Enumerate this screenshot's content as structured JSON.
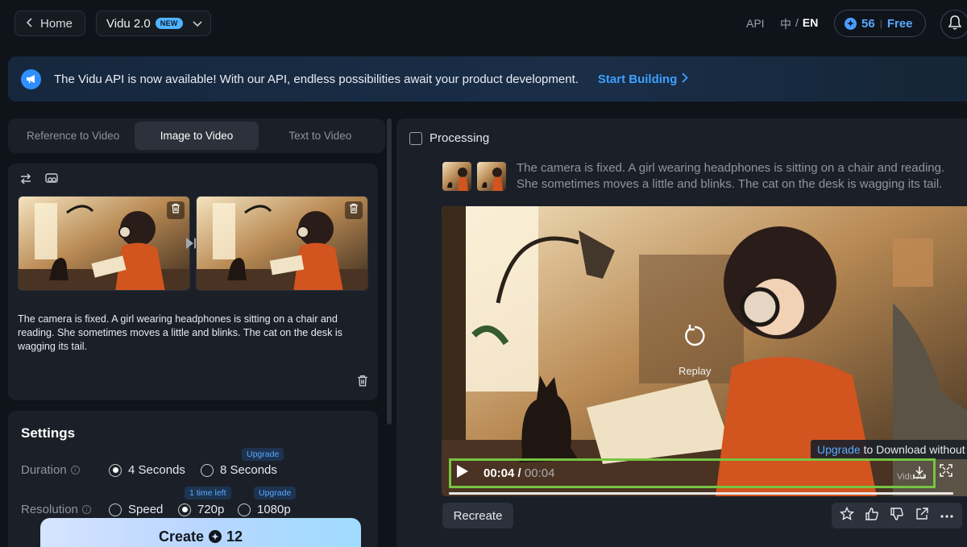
{
  "header": {
    "home_label": "Home",
    "model_label": "Vidu 2.0",
    "new_badge": "NEW",
    "api_label": "API",
    "lang_zh": "中",
    "lang_sep": "/",
    "lang_en": "EN",
    "credits_value": "56",
    "credits_sep": "|",
    "plan_label": "Free"
  },
  "banner": {
    "text": "The Vidu API is now available! With our API, endless possibilities await your product development.",
    "link_label": "Start Building"
  },
  "tabs": [
    {
      "label": "Reference to Video",
      "active": false
    },
    {
      "label": "Image to Video",
      "active": true
    },
    {
      "label": "Text to Video",
      "active": false
    }
  ],
  "input": {
    "prompt": "The camera is fixed. A girl wearing headphones is sitting on a chair and reading. She sometimes moves a little and blinks. The cat on the desk is wagging its tail."
  },
  "settings": {
    "title": "Settings",
    "duration_label": "Duration",
    "duration_options": [
      "4 Seconds",
      "8 Seconds"
    ],
    "duration_selected": "4 Seconds",
    "duration_upgrade_tag": "Upgrade",
    "resolution_label": "Resolution",
    "resolution_options": [
      "Speed",
      "720p",
      "1080p"
    ],
    "resolution_selected": "720p",
    "time_left_tag": "1 time left",
    "resolution_upgrade_tag": "Upgrade"
  },
  "create": {
    "label": "Create",
    "cost": "12"
  },
  "result": {
    "status": "Processing",
    "prompt": "The camera is fixed. A girl wearing headphones is sitting on a chair and reading. She sometimes moves a little and blinks. The cat on the desk is wagging its tail.",
    "replay_label": "Replay",
    "upgrade_link": "Upgrade",
    "upgrade_text": " to Download without",
    "time_current": "00:04",
    "time_sep": "/",
    "time_total": "00:04",
    "watermark": "Vidu AI",
    "recreate_label": "Recreate",
    "progress": 1.0
  },
  "colors": {
    "accent": "#3ea0ff",
    "highlight_border": "#76c442",
    "background": "#0f141b",
    "panel": "#1b2028"
  },
  "icons": [
    "chevron-left-icon",
    "chevron-down-icon",
    "coin-icon",
    "bell-icon",
    "megaphone-icon",
    "chevron-right-icon",
    "swap-icon",
    "image-edit-icon",
    "trash-icon",
    "replay-icon",
    "play-icon",
    "download-icon",
    "fullscreen-icon",
    "star-icon",
    "thumbs-up-icon",
    "thumbs-down-icon",
    "share-icon",
    "more-icon"
  ]
}
